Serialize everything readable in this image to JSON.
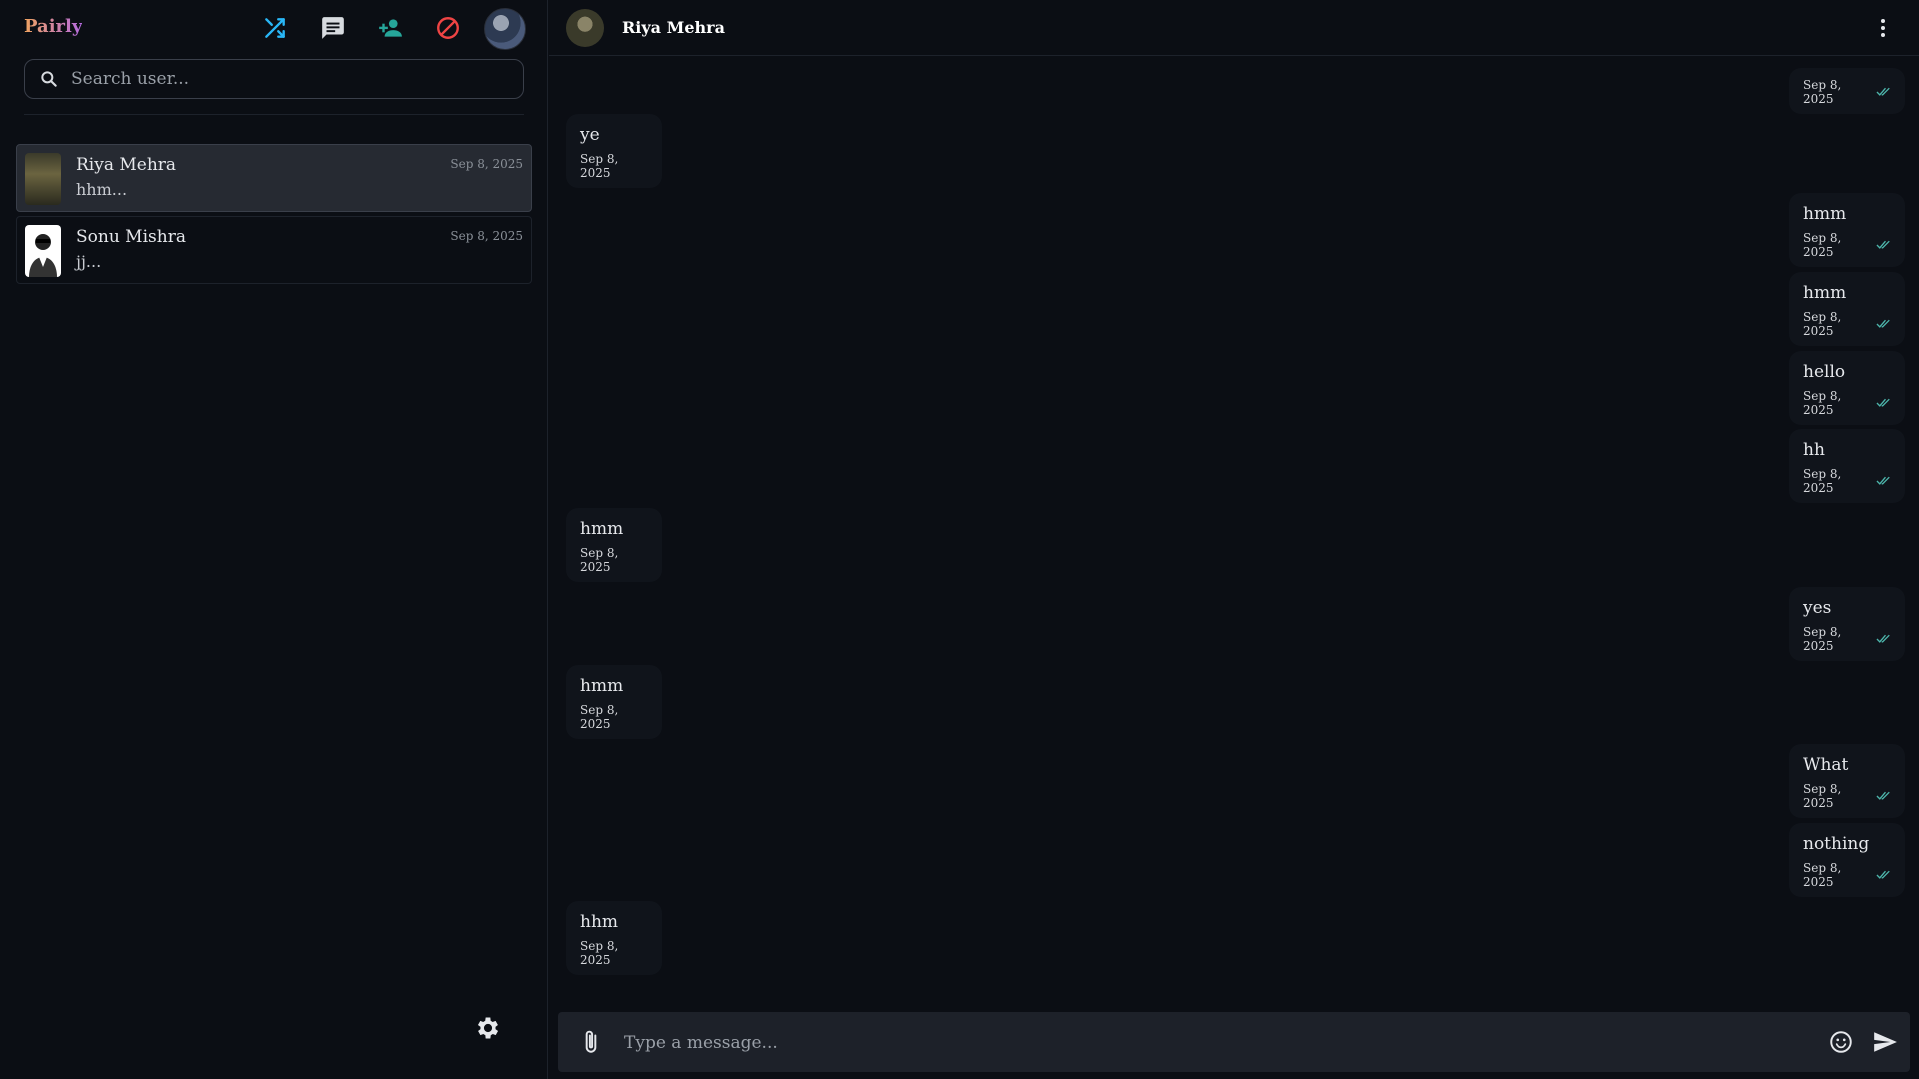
{
  "app": {
    "name": "Pairly"
  },
  "toolbar": {
    "icons": [
      "shuffle-icon",
      "chat-icon",
      "add-user-icon",
      "block-icon"
    ],
    "accent": "#29b6f6",
    "block_color": "#ef4444"
  },
  "search": {
    "placeholder": "Search user..."
  },
  "chats": [
    {
      "name": "Riya Mehra",
      "preview": "hhm...",
      "date": "Sep 8, 2025",
      "active": true
    },
    {
      "name": "Sonu Mishra",
      "preview": "jj...",
      "date": "Sep 8, 2025",
      "active": false
    }
  ],
  "conversation": {
    "contact_name": "Riya Mehra",
    "messages": [
      {
        "dir": "out",
        "text": "",
        "time": "Sep 8, 2025"
      },
      {
        "dir": "in",
        "text": "ye",
        "time": "Sep 8, 2025"
      },
      {
        "dir": "out",
        "text": "hmm",
        "time": "Sep 8, 2025"
      },
      {
        "dir": "out",
        "text": "hmm",
        "time": "Sep 8, 2025"
      },
      {
        "dir": "out",
        "text": "hello",
        "time": "Sep 8, 2025"
      },
      {
        "dir": "out",
        "text": "hh",
        "time": "Sep 8, 2025"
      },
      {
        "dir": "in",
        "text": "hmm",
        "time": "Sep 8, 2025"
      },
      {
        "dir": "out",
        "text": "yes",
        "time": "Sep 8, 2025"
      },
      {
        "dir": "in",
        "text": "hmm",
        "time": "Sep 8, 2025"
      },
      {
        "dir": "out",
        "text": "What",
        "time": "Sep 8, 2025"
      },
      {
        "dir": "out",
        "text": "nothing",
        "time": "Sep 8, 2025"
      },
      {
        "dir": "in",
        "text": "hhm",
        "time": "Sep 8, 2025"
      }
    ]
  },
  "composer": {
    "placeholder": "Type a message..."
  }
}
